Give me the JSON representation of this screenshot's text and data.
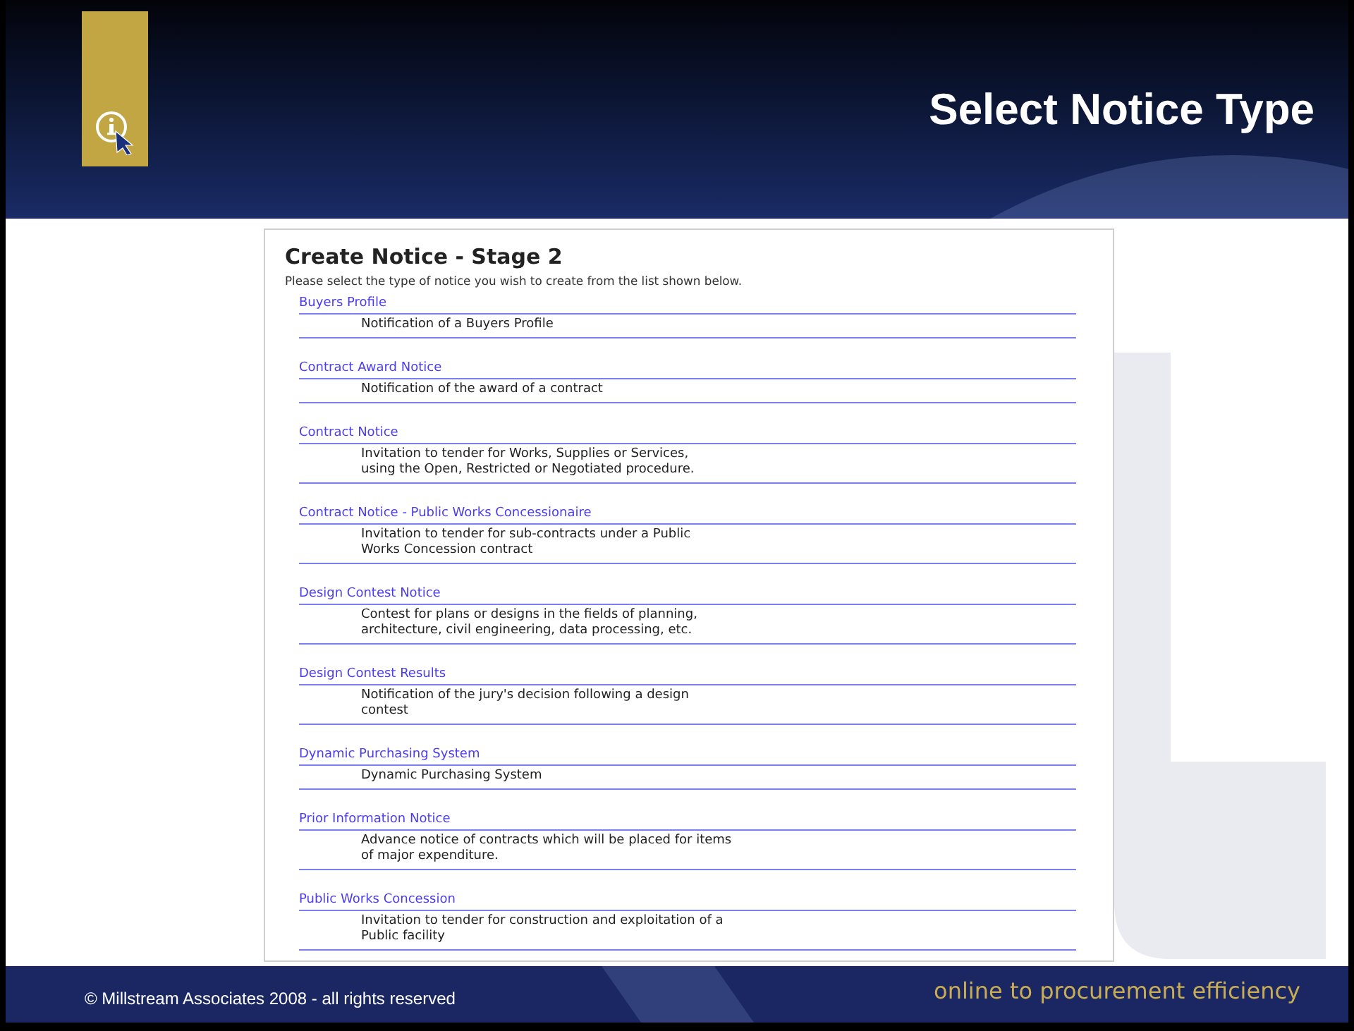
{
  "header": {
    "title": "Select Notice Type"
  },
  "panel": {
    "heading": "Create Notice - Stage 2",
    "intro": "Please select the type of notice you wish to create from the list shown below.",
    "notice_types": [
      {
        "name": "Buyers Profile",
        "description": "Notification of a Buyers Profile"
      },
      {
        "name": "Contract Award Notice",
        "description": "Notification of the award of a contract"
      },
      {
        "name": "Contract Notice",
        "description": "Invitation to tender for Works, Supplies or Services,\nusing the Open, Restricted or Negotiated procedure."
      },
      {
        "name": "Contract Notice - Public Works Concessionaire",
        "description": "Invitation to tender for sub-contracts under a Public\nWorks Concession contract"
      },
      {
        "name": "Design Contest Notice",
        "description": "Contest for plans or designs in the fields of planning,\narchitecture, civil engineering, data processing, etc."
      },
      {
        "name": "Design Contest Results",
        "description": "Notification of the jury's decision following a design\ncontest"
      },
      {
        "name": "Dynamic Purchasing System",
        "description": "Dynamic Purchasing System"
      },
      {
        "name": "Prior Information Notice",
        "description": "Advance notice of contracts which will be placed for items\nof major expenditure."
      },
      {
        "name": "Public Works Concession",
        "description": "Invitation to tender for construction and exploitation of a\nPublic facility"
      }
    ]
  },
  "footer": {
    "copyright": "© Millstream Associates 2008 - all rights reserved",
    "tagline": "online to procurement efficiency"
  }
}
